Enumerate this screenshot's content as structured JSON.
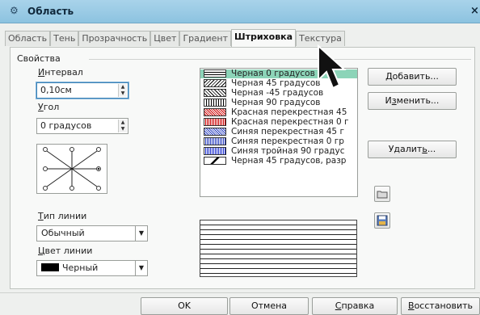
{
  "window": {
    "title": "Область",
    "close_glyph": "×"
  },
  "tabs": [
    {
      "label": "Область",
      "active": false
    },
    {
      "label": "Тень",
      "active": false
    },
    {
      "label": "Прозрачность",
      "active": false
    },
    {
      "label": "Цвет",
      "active": false
    },
    {
      "label": "Градиент",
      "active": false
    },
    {
      "label": "Штриховка",
      "active": true
    },
    {
      "label": "Текстура",
      "active": false
    }
  ],
  "properties": {
    "group_title": "Свойства",
    "interval_label_u": "И",
    "interval_label_rest": "нтервал",
    "interval_value": "0,10см",
    "angle_label_u": "У",
    "angle_label_rest": "гол",
    "angle_value": "0 градусов",
    "line_type_label_u": "Т",
    "line_type_label_rest": "ип линии",
    "line_type_value": "Обычный",
    "line_color_label_u": "Ц",
    "line_color_label_rest": "вет линии",
    "line_color_value": "Черный"
  },
  "hatch_list": [
    {
      "label": "Черная 0 градусов",
      "selected": true
    },
    {
      "label": "Черная 45 градусов",
      "selected": false
    },
    {
      "label": "Черная -45 градусов",
      "selected": false
    },
    {
      "label": "Черная 90 градусов",
      "selected": false
    },
    {
      "label": "Красная перекрестная 45",
      "selected": false
    },
    {
      "label": "Красная перекрестная 0 г",
      "selected": false
    },
    {
      "label": "Синяя перекрестная 45 г",
      "selected": false
    },
    {
      "label": "Синяя перекрестная 0 гр",
      "selected": false
    },
    {
      "label": "Синяя тройная 90 градус",
      "selected": false
    },
    {
      "label": "Черная 45 градусов, разр",
      "selected": false
    }
  ],
  "buttons": {
    "add_u": "Д",
    "add_rest": "обавить...",
    "modify_pre": "И",
    "modify_u": "з",
    "modify_rest": "менить...",
    "delete_pre": "Удалит",
    "delete_u": "ь",
    "delete_rest": "...",
    "ok": "OK",
    "cancel": "Отмена",
    "help_u": "С",
    "help_rest": "правка",
    "reset_u": "В",
    "reset_rest": "осстановить"
  },
  "colors": {
    "selection": "#8cd4b8",
    "titlebar": "#9ccbe5"
  }
}
